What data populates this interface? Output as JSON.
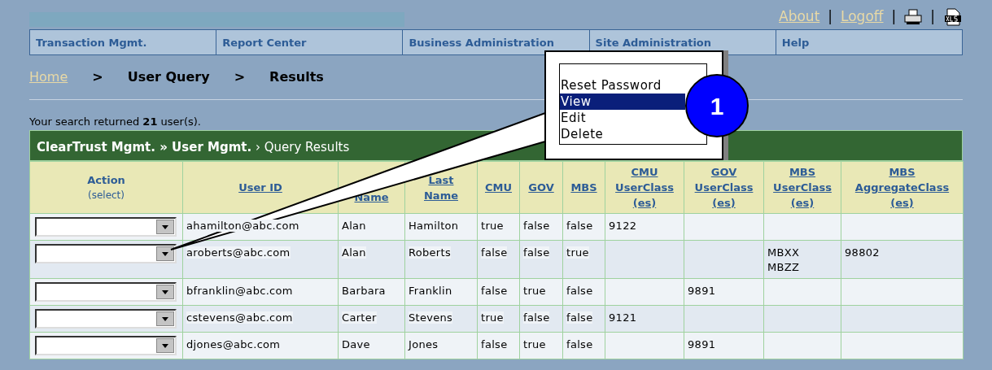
{
  "header_links": [
    {
      "label": "About",
      "kind": "link"
    },
    {
      "label": "|",
      "kind": "separator"
    },
    {
      "label": "Logoff",
      "kind": "link"
    },
    {
      "label": "|",
      "kind": "separator"
    },
    {
      "kind": "print"
    },
    {
      "label": "|",
      "kind": "separator"
    },
    {
      "kind": "xls"
    }
  ],
  "nav_tabs": [
    "Transaction Mgmt.",
    "Report Center",
    "Business Administration",
    "Site Administration",
    "Help"
  ],
  "breadcrumb": [
    {
      "label": "Home",
      "kind": "link"
    },
    {
      "label": ">",
      "kind": "separator"
    },
    {
      "label": "User Query",
      "kind": "current"
    },
    {
      "label": ">",
      "kind": "separator"
    },
    {
      "label": "Results",
      "kind": "current"
    }
  ],
  "search_summary": "Your search returned **21** user(s).",
  "panel_title": "**ClearTrust Mgmt. » User Mgmt.** › Query Results",
  "table": {
    "columns": [
      {
        "lines": [
          "Action"
        ],
        "sublabel": "(select)",
        "kind": "plain"
      },
      {
        "lines": [
          "User ID"
        ],
        "kind": "link"
      },
      {
        "lines": [
          "Name"
        ],
        "kind": "link_lower"
      },
      {
        "lines": [
          "Last",
          "Name"
        ],
        "kind": "link"
      },
      {
        "lines": [
          "CMU"
        ],
        "kind": "link"
      },
      {
        "lines": [
          "GOV"
        ],
        "kind": "link"
      },
      {
        "lines": [
          "MBS"
        ],
        "kind": "link"
      },
      {
        "lines": [
          "CMU",
          "UserClass",
          "(es)"
        ],
        "kind": "link"
      },
      {
        "lines": [
          "GOV",
          "UserClass",
          "(es)"
        ],
        "kind": "link"
      },
      {
        "lines": [
          "MBS",
          "UserClass",
          "(es)"
        ],
        "kind": "link"
      },
      {
        "lines": [
          "MBS",
          "AggregateClass",
          "(es)"
        ],
        "kind": "link"
      }
    ],
    "rows": [
      {
        "user_id": "ahamilton@abc.com",
        "first_name": "Alan",
        "last_name": "Hamilton",
        "cmu": "true",
        "gov": "false",
        "mbs": "false",
        "cmu_userclass": [
          "9122"
        ]
      },
      {
        "user_id": "aroberts@abc.com",
        "first_name": "Alan",
        "last_name": "Roberts",
        "cmu": "false",
        "gov": "false",
        "mbs": "true",
        "mbs_userclass": [
          "MBXX",
          "MBZZ"
        ],
        "mbs_aggregateclass": [
          "98802"
        ]
      },
      {
        "user_id": "bfranklin@abc.com",
        "first_name": "Barbara",
        "last_name": "Franklin",
        "cmu": "false",
        "gov": "true",
        "mbs": "false",
        "gov_userclass": [
          "9891"
        ]
      },
      {
        "user_id": "cstevens@abc.com",
        "first_name": "Carter",
        "last_name": "Stevens",
        "cmu": "true",
        "gov": "false",
        "mbs": "false",
        "cmu_userclass": [
          "9121"
        ]
      },
      {
        "user_id": "djones@abc.com",
        "first_name": "Dave",
        "last_name": "Jones",
        "cmu": "false",
        "gov": "true",
        "mbs": "false",
        "gov_userclass": [
          "9891"
        ]
      }
    ]
  },
  "callout": {
    "badge": "1",
    "options": [
      {
        "label": "Reset Password",
        "selected": false
      },
      {
        "label": "View",
        "selected": true
      },
      {
        "label": "Edit",
        "selected": false
      },
      {
        "label": "Delete",
        "selected": false
      }
    ]
  }
}
